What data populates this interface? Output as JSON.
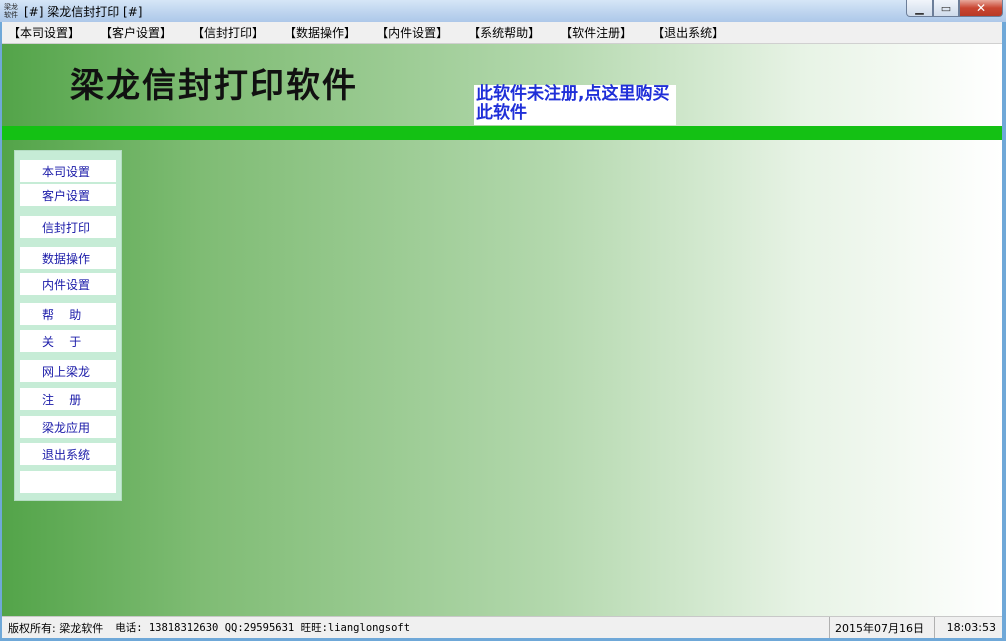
{
  "window": {
    "icon_text_line1": "梁龙",
    "icon_text_line2": "软件",
    "title": "[#] 梁龙信封打印 [#]"
  },
  "menu": [
    "【本司设置】",
    "【客户设置】",
    "【信封打印】",
    "【数据操作】",
    "【内件设置】",
    "【系统帮助】",
    "【软件注册】",
    "【退出系统】"
  ],
  "main": {
    "app_title": "梁龙信封打印软件",
    "registration_notice": "此软件未注册,点这里购买此软件"
  },
  "sidebar": [
    "本司设置",
    "客户设置",
    "信封打印",
    "数据操作",
    "内件设置",
    "帮    助",
    "关    于",
    "网上梁龙",
    "注    册",
    "梁龙应用",
    "退出系统"
  ],
  "status": {
    "copyright": "版权所有: 梁龙软件",
    "contact": "电话: 13818312630 QQ:29595631 旺旺:lianglongsoft",
    "date": "2015年07月16日",
    "time": "18:03:53"
  },
  "colors": {
    "accent_green": "#14c114",
    "link_blue": "#1f2fd8"
  }
}
